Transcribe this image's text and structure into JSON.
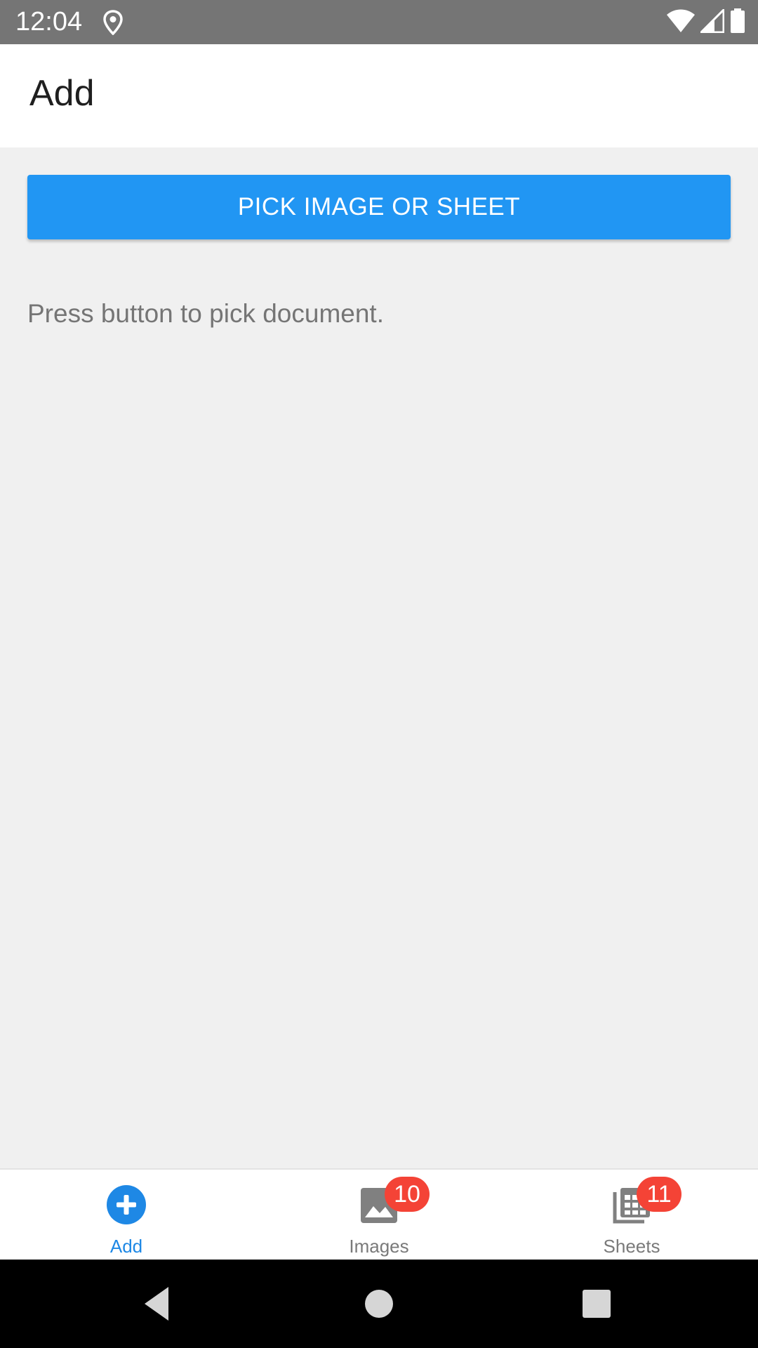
{
  "status_bar": {
    "time": "12:04",
    "icons": [
      "location-icon",
      "wifi-icon",
      "signal-icon",
      "battery-icon"
    ]
  },
  "app_bar": {
    "title": "Add"
  },
  "content": {
    "pick_button_label": "PICK IMAGE OR SHEET",
    "hint": "Press button to pick document."
  },
  "tabs": [
    {
      "label": "Add",
      "icon": "add-circle-icon",
      "active": true,
      "badge": null
    },
    {
      "label": "Images",
      "icon": "image-icon",
      "active": false,
      "badge": "10"
    },
    {
      "label": "Sheets",
      "icon": "sheets-icon",
      "active": false,
      "badge": "11"
    }
  ],
  "nav_bar": {
    "buttons": [
      "back-icon",
      "home-icon",
      "recents-icon"
    ]
  },
  "colors": {
    "accent": "#2196f3",
    "active_tab": "#1e88e5",
    "badge": "#f44336",
    "status_bar": "#757575",
    "background": "#f0f0f0"
  }
}
